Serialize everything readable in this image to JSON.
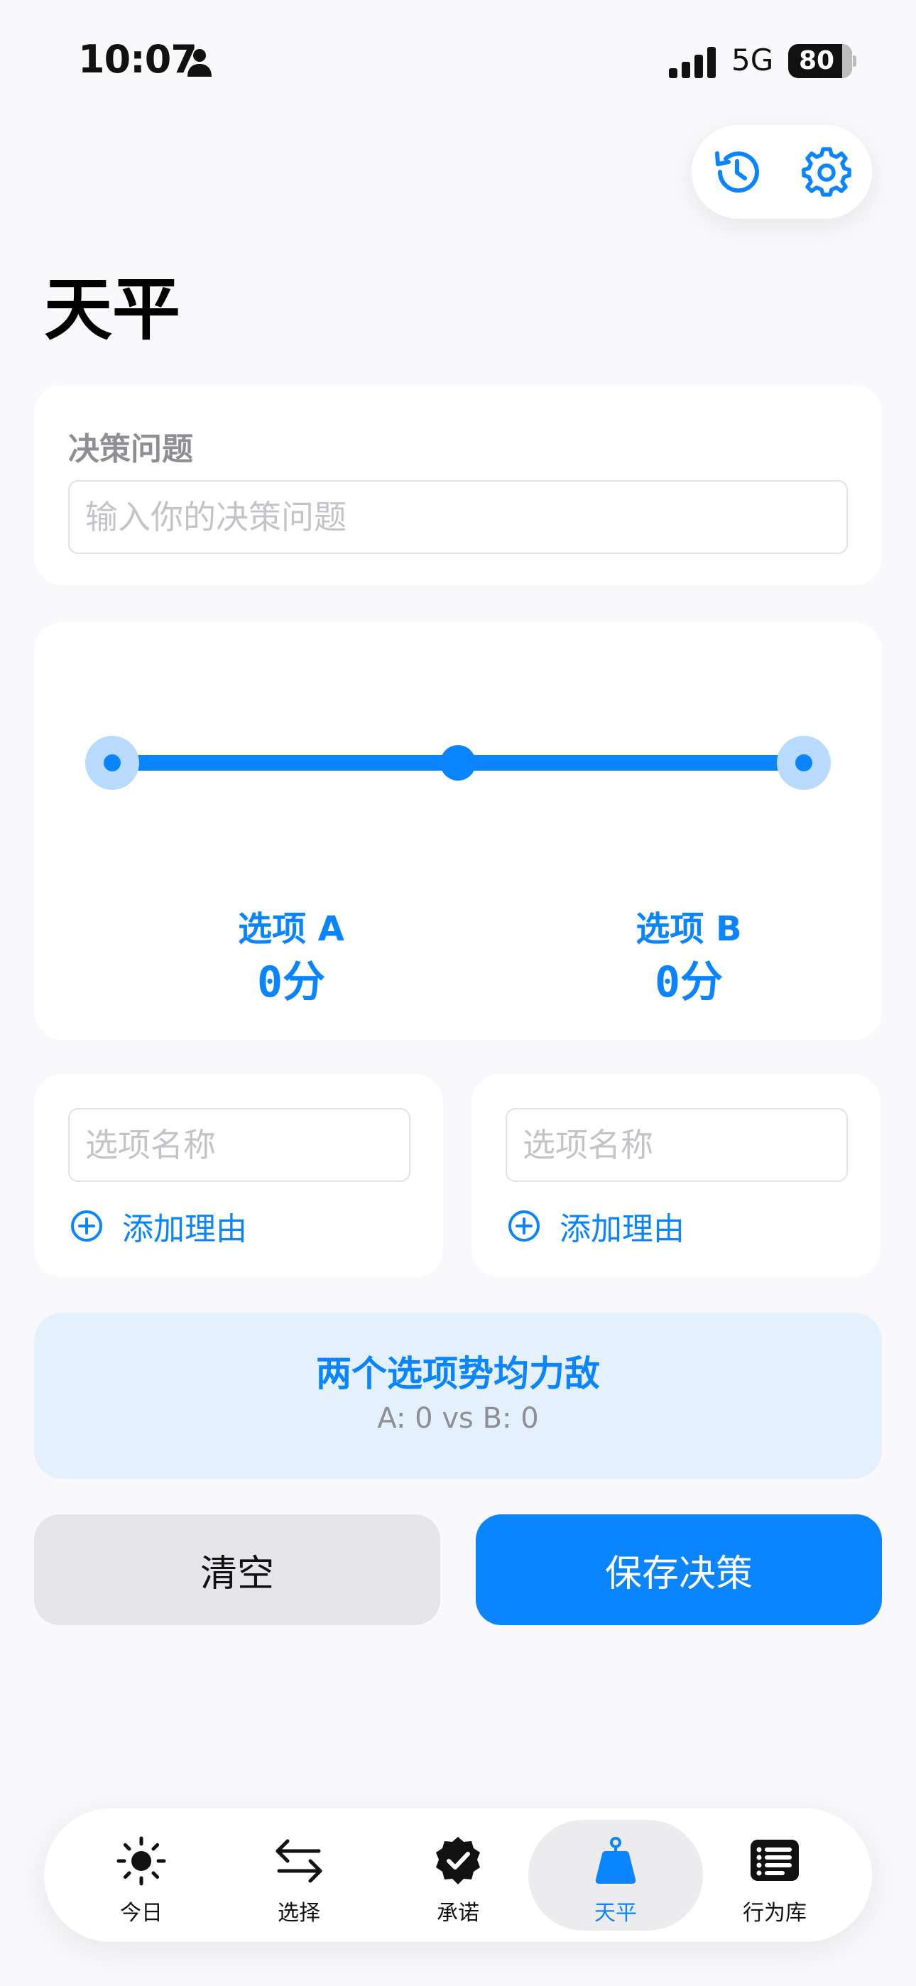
{
  "status": {
    "time": "10:07",
    "network": "5G",
    "battery": "80"
  },
  "page": {
    "title": "天平"
  },
  "question": {
    "label": "决策问题",
    "placeholder": "输入你的决策问题",
    "value": ""
  },
  "balance": {
    "tilt": 0,
    "option_a": {
      "label": "选项 A",
      "score": "0分"
    },
    "option_b": {
      "label": "选项 B",
      "score": "0分"
    }
  },
  "options": [
    {
      "name_placeholder": "选项名称",
      "add_reason_label": "添加理由"
    },
    {
      "name_placeholder": "选项名称",
      "add_reason_label": "添加理由"
    }
  ],
  "result": {
    "title": "两个选项势均力敌",
    "scores": "A: 0 vs B: 0"
  },
  "actions": {
    "clear_label": "清空",
    "save_label": "保存决策"
  },
  "tabs": [
    {
      "label": "今日",
      "icon": "sun-icon",
      "active": false
    },
    {
      "label": "选择",
      "icon": "arrows-swap-icon",
      "active": false
    },
    {
      "label": "承诺",
      "icon": "checkmark-seal-icon",
      "active": false
    },
    {
      "label": "天平",
      "icon": "scale-weight-icon",
      "active": true
    },
    {
      "label": "行为库",
      "icon": "list-icon",
      "active": false
    }
  ],
  "colors": {
    "accent": "#0a84ff",
    "accent_light": "#b7dafd",
    "banner_bg": "#e4f1fd",
    "secondary_text": "#8e8e93"
  }
}
